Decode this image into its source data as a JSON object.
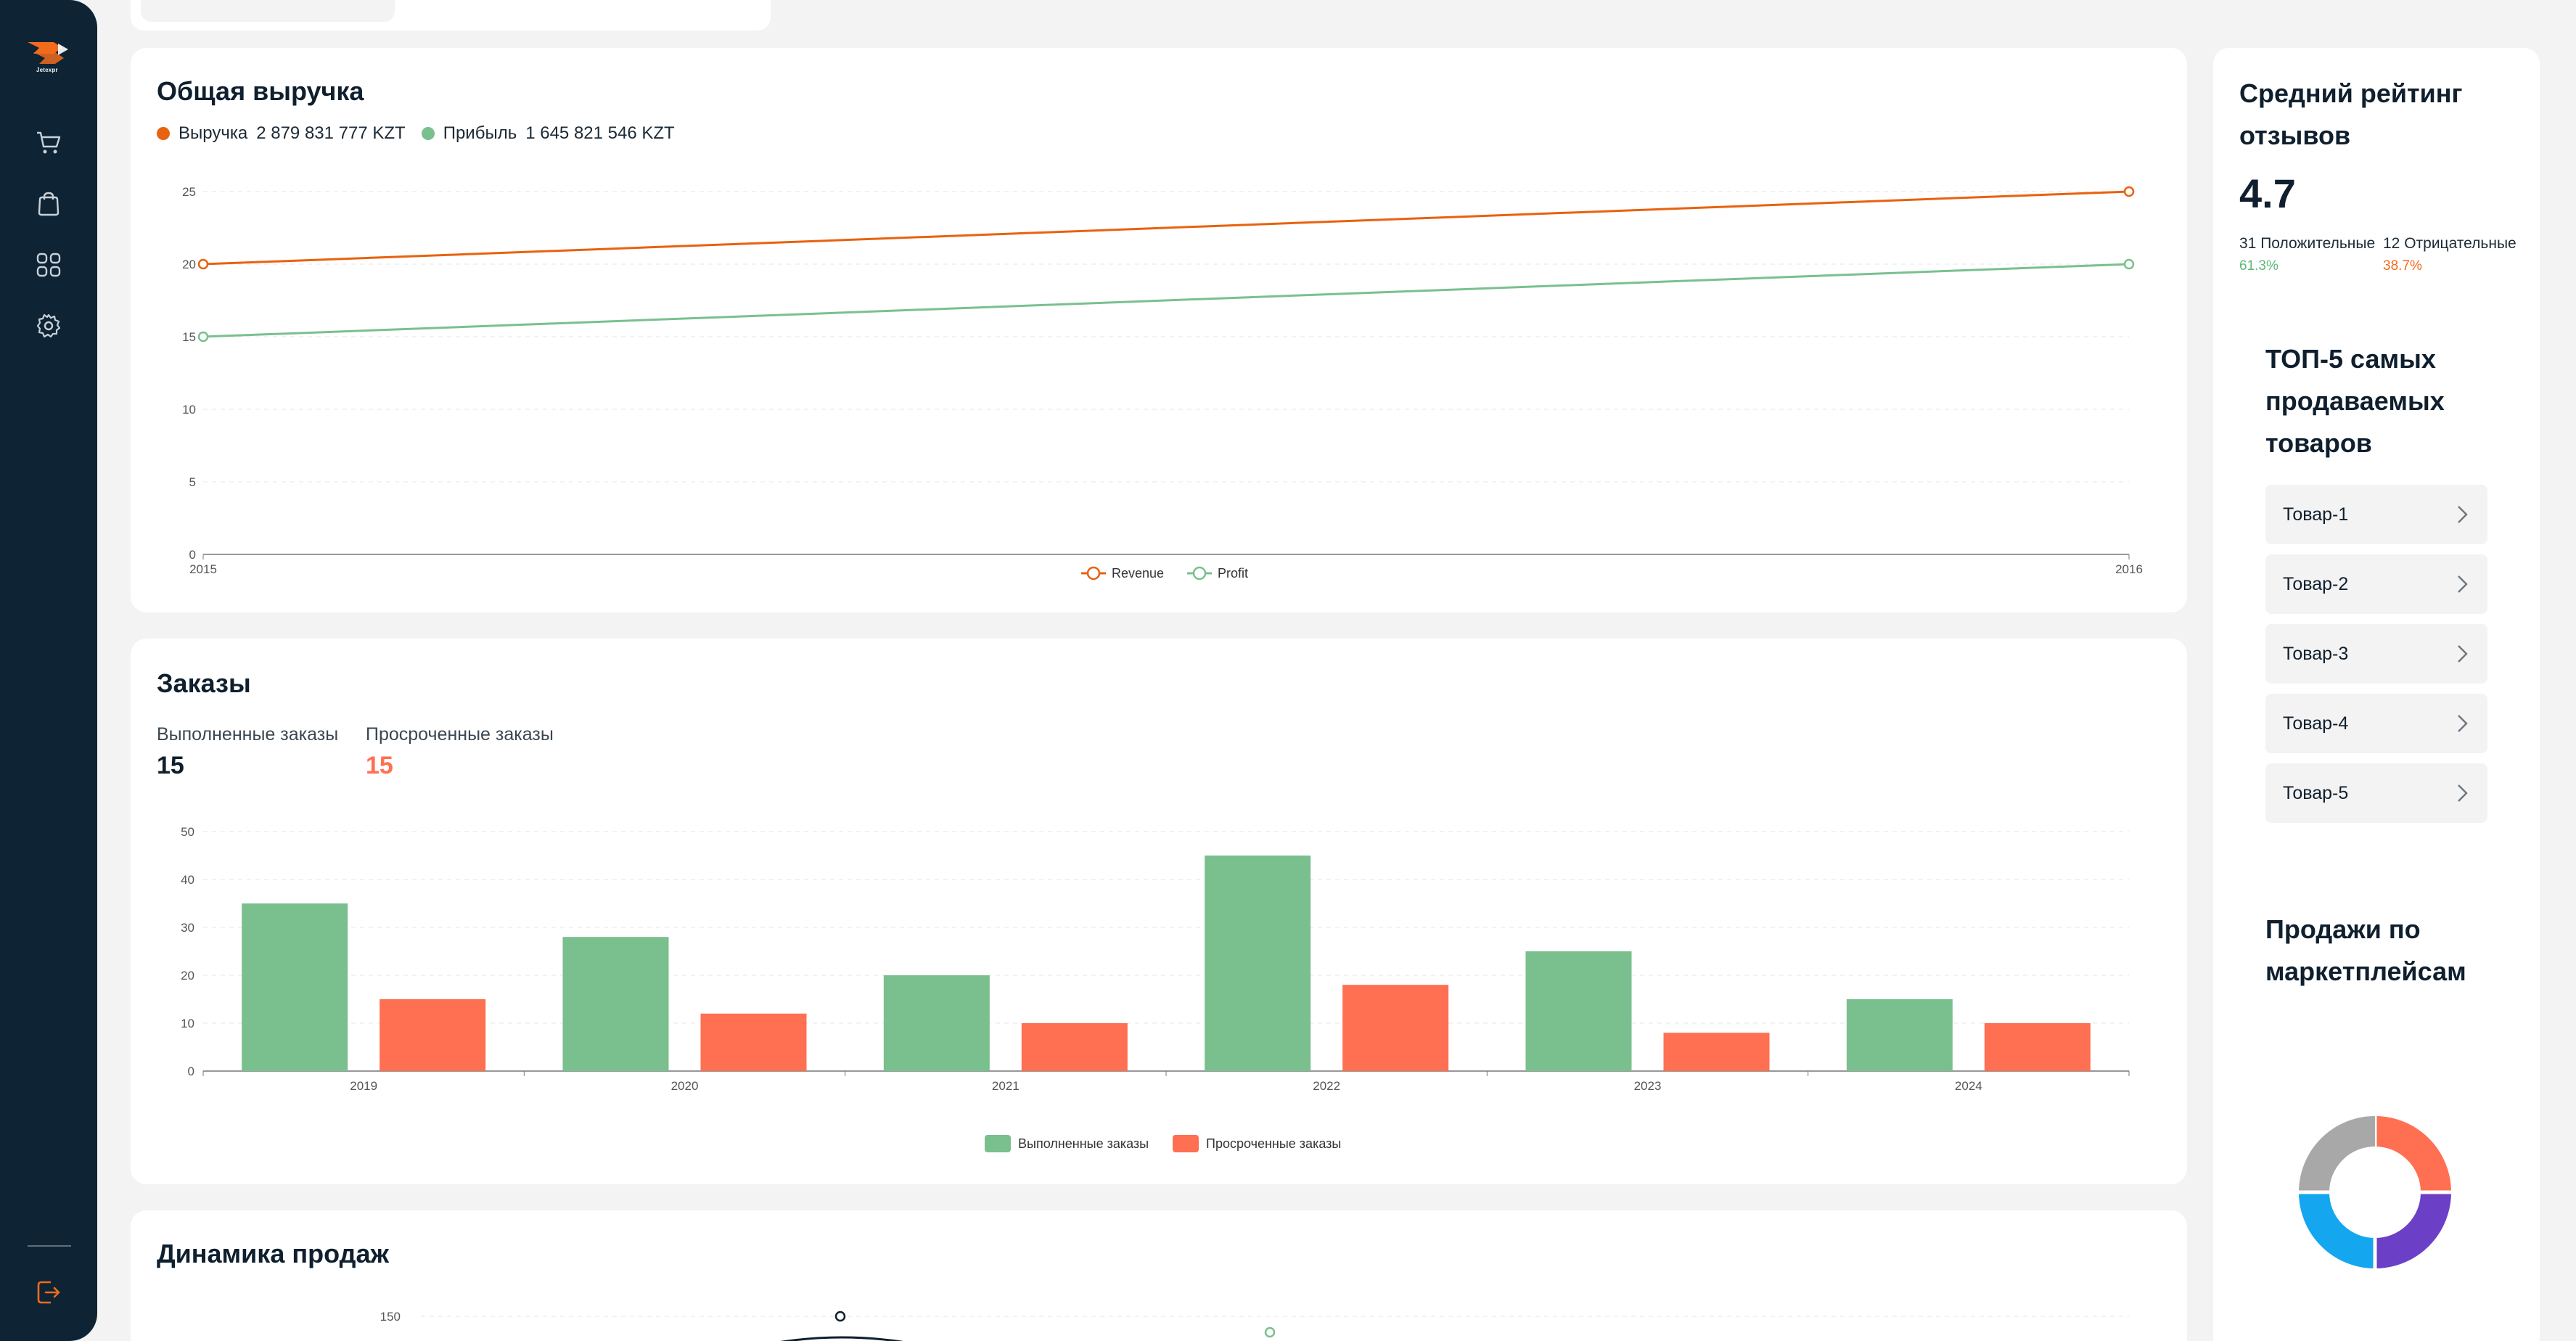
{
  "sidebar": {
    "logo_text": "Jetexpr",
    "items": [
      {
        "name": "cart-icon"
      },
      {
        "name": "bag-icon"
      },
      {
        "name": "grid-icon"
      },
      {
        "name": "gear-icon"
      }
    ],
    "logout_icon": "logout-icon",
    "accent": "#f26b1d"
  },
  "revenue": {
    "title": "Общая выручка",
    "legend": [
      {
        "label": "Выручка",
        "value": "2 879 831 777 KZT",
        "color": "#e8620f"
      },
      {
        "label": "Прибыль",
        "value": "1 645 821 546 KZT",
        "color": "#7ac08f"
      }
    ]
  },
  "orders": {
    "title": "Заказы",
    "completed_label": "Выполненные заказы",
    "completed_value": "15",
    "overdue_label": "Просроченные заказы",
    "overdue_value": "15"
  },
  "dynamics": {
    "title": "Динамика продаж"
  },
  "rating": {
    "title": "Средний рейтинг отзывов",
    "value": "4.7",
    "positive_label": "31 Положительные",
    "positive_pct": "61.3%",
    "negative_label": "12 Отрицательные",
    "negative_pct": "38.7%"
  },
  "top_products": {
    "title": "ТОП-5 самых продаваемых товаров",
    "items": [
      "Товар-1",
      "Товар-2",
      "Товар-3",
      "Товар-4",
      "Товар-5"
    ]
  },
  "marketplaces": {
    "title": "Продажи по маркетплейсам"
  },
  "chart_data": [
    {
      "type": "line",
      "x": [
        "2015",
        "2016"
      ],
      "series": [
        {
          "name": "Revenue",
          "values": [
            20,
            25
          ],
          "color": "#e8620f"
        },
        {
          "name": "Profit",
          "values": [
            15,
            20
          ],
          "color": "#7ac08f"
        }
      ],
      "ylim": [
        0,
        25
      ],
      "yticks": [
        0,
        5,
        10,
        15,
        20,
        25
      ],
      "grid": true,
      "legend": "bottom"
    },
    {
      "type": "bar",
      "categories": [
        "2019",
        "2020",
        "2021",
        "2022",
        "2023",
        "2024"
      ],
      "series": [
        {
          "name": "Выполненные заказы",
          "values": [
            35,
            28,
            20,
            45,
            25,
            15
          ],
          "color": "#7abf8e"
        },
        {
          "name": "Просроченные заказы",
          "values": [
            15,
            12,
            10,
            18,
            8,
            10
          ],
          "color": "#ff6f51"
        }
      ],
      "ylim": [
        0,
        50
      ],
      "yticks": [
        0,
        10,
        20,
        30,
        40,
        50
      ],
      "grid": true,
      "legend": "bottom"
    },
    {
      "type": "pie",
      "series": [
        {
          "name": "",
          "values": [
            25,
            25,
            25,
            25
          ]
        }
      ],
      "colors": [
        "#ff6f51",
        "#6c3fc7",
        "#14a6ef",
        "#a8a8a8"
      ]
    },
    {
      "type": "line",
      "x": [],
      "series": [],
      "yticks_visible": [
        150
      ]
    }
  ]
}
